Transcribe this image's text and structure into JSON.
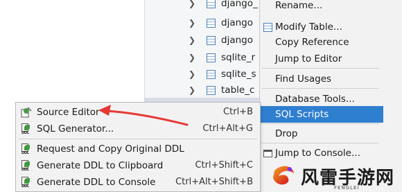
{
  "tree": {
    "rows": [
      {
        "label": "django_"
      },
      {
        "label": "django"
      },
      {
        "label": "django"
      },
      {
        "label": "sqlite_r"
      },
      {
        "label": "sqlite_s"
      },
      {
        "label": "table_c"
      }
    ]
  },
  "context_menu": {
    "items": [
      {
        "label": "Rename...",
        "icon": "none"
      },
      {
        "label": "Modify Table...",
        "icon": "table-icon"
      },
      {
        "label": "Copy Reference",
        "icon": "none"
      },
      {
        "label": "Jump to Editor",
        "icon": "none"
      },
      {
        "label": "Find Usages",
        "icon": "none"
      },
      {
        "label": "Database Tools...",
        "icon": "none"
      },
      {
        "label": "SQL Scripts",
        "icon": "none",
        "selected": true
      },
      {
        "label": "Drop",
        "icon": "none"
      },
      {
        "label": "Jump to Console...",
        "icon": "console-icon"
      }
    ]
  },
  "submenu": {
    "items": [
      {
        "label": "Source Editor",
        "shortcut": "Ctrl+B",
        "icon": "source-editor-icon"
      },
      {
        "label": "SQL Generator...",
        "shortcut": "Ctrl+Alt+G",
        "icon": "ddl-icon"
      },
      {
        "label": "Request and Copy Original DDL",
        "shortcut": "",
        "icon": "ddl-icon"
      },
      {
        "label": "Generate DDL to Clipboard",
        "shortcut": "Ctrl+Shift+C",
        "icon": "ddl-icon"
      },
      {
        "label": "Generate DDL to Console",
        "shortcut": "Ctrl+Alt+Shift+B",
        "icon": "ddl-icon"
      }
    ]
  },
  "watermark": {
    "title": "风雷手游网",
    "subtitle": "FENGLEI"
  },
  "colors": {
    "selection": "#2f7fd0",
    "arrow": "#e53935",
    "menu_bg": "#f2f2f2"
  }
}
